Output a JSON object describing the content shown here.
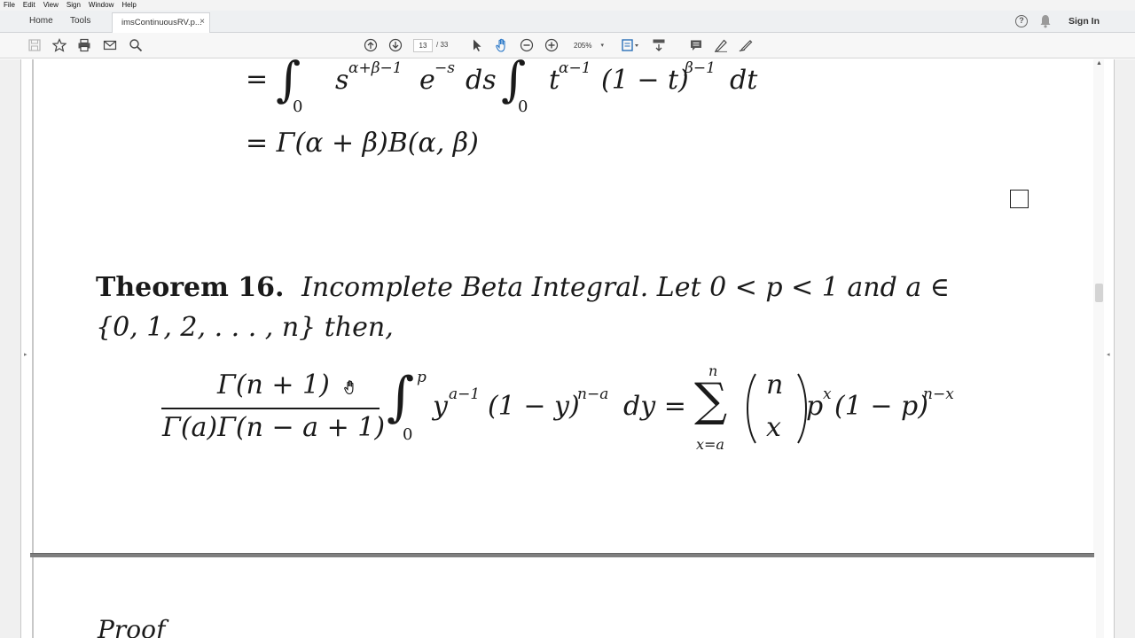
{
  "menu": [
    "File",
    "Edit",
    "View",
    "Sign",
    "Window",
    "Help"
  ],
  "tabs": {
    "home": "Home",
    "tools": "Tools",
    "document": "imsContinuousRV.p...",
    "close": "×"
  },
  "header": {
    "sign_in": "Sign In",
    "help": "?"
  },
  "toolbar": {
    "current_page": "13",
    "page_separator": "/ 33",
    "zoom": "205%",
    "zoom_caret": "▾"
  },
  "document": {
    "eq_line1": {
      "eq": "=",
      "integral": "∫",
      "lower": "0",
      "s": "s",
      "s_exp": "α+β−1",
      "e": "e",
      "e_exp": "−s",
      "ds": "ds",
      "integral2": "∫",
      "lower2": "0",
      "t": "t",
      "t_exp": "α−1",
      "paren": "(1 − t)",
      "paren_exp": "β−1",
      "dt": "dt"
    },
    "eq_line2": "= Γ(α + β)B(α, β)",
    "theorem_label": "Theorem 16.",
    "theorem_text": "Incomplete Beta Integral.  Let 0 < p < 1 and a ∈",
    "theorem_text2": "{0, 1, 2, . . . , n} then,",
    "formula": {
      "numerator": "Γ(n + 1)",
      "denominator": "Γ(a)Γ(n − a + 1)",
      "integral": "∫",
      "upper": "p",
      "lower": "0",
      "y": "y",
      "y_exp": "a−1",
      "one_minus_y": "(1 − y)",
      "one_minus_y_exp": "n−a",
      "dy": "dy =",
      "sum": "∑",
      "sum_upper": "n",
      "sum_lower": "x=a",
      "binom_top": "n",
      "binom_bottom": "x",
      "p": "p",
      "p_exp": "x",
      "one_minus_p": "(1 − p)",
      "one_minus_p_exp": "n−x"
    },
    "proof_label": "Proof"
  }
}
